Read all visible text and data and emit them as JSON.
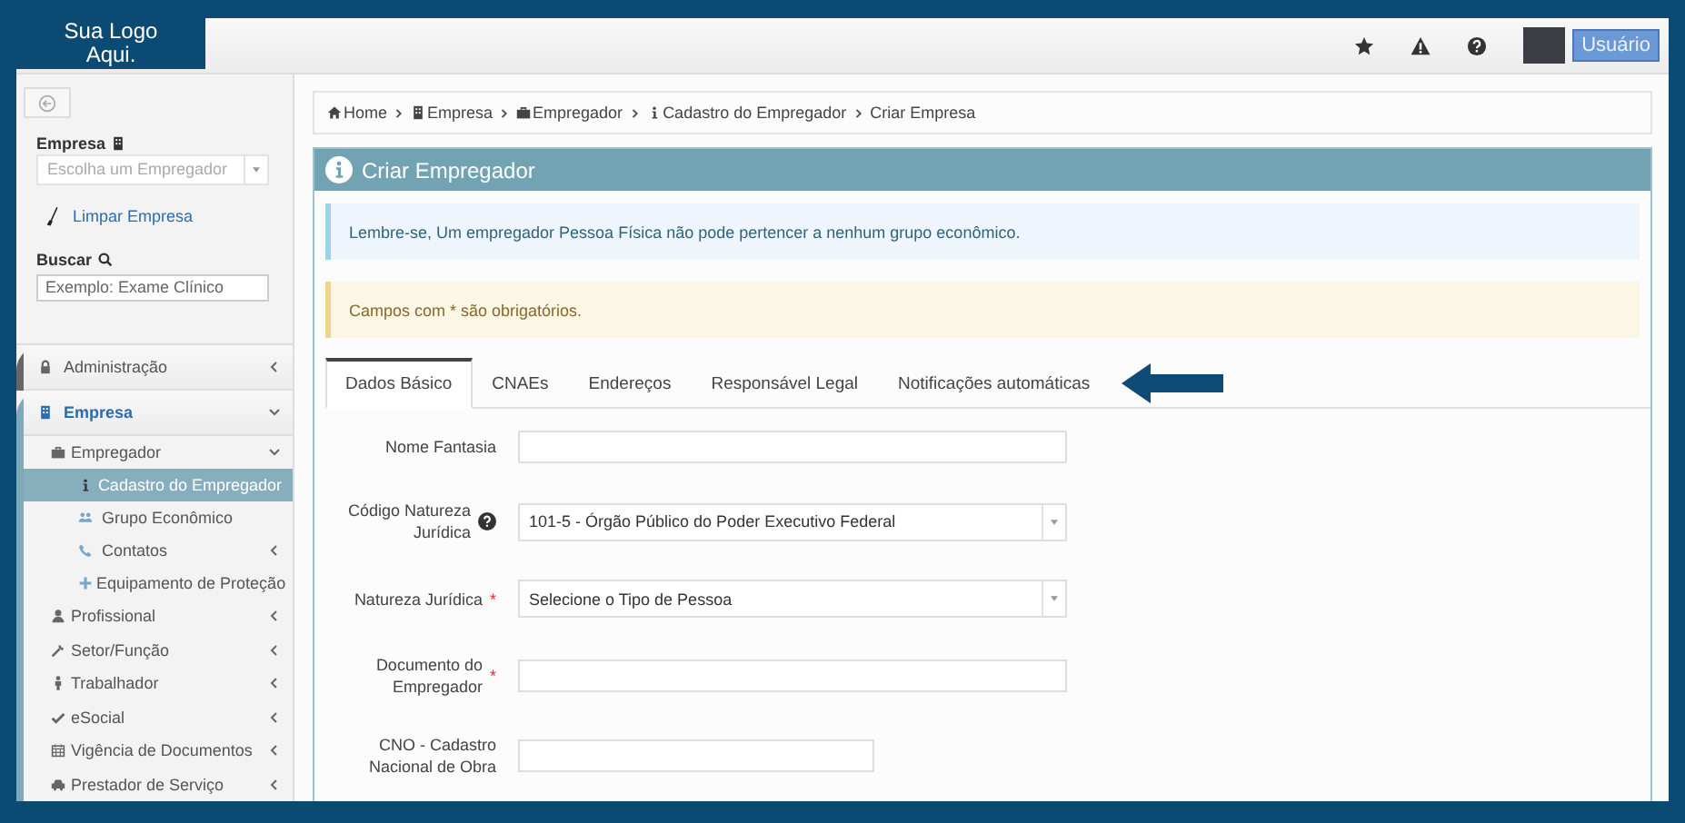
{
  "header": {
    "logo": "Sua Logo Aqui.",
    "user_button": "Usuário"
  },
  "sidebar": {
    "company_label": "Empresa",
    "company_select": {
      "placeholder": "Escolha um Empregador"
    },
    "clear_link": "Limpar Empresa",
    "search_label": "Buscar",
    "search": {
      "placeholder": "Exemplo: Exame Clínico"
    },
    "menu": [
      {
        "label": "Administração",
        "selected": false,
        "expanded": false
      },
      {
        "label": "Empresa",
        "selected": true,
        "expanded": true,
        "children": [
          {
            "label": "Empregador",
            "selected": false,
            "expanded": true,
            "children": [
              {
                "label": "Cadastro do Empregador",
                "selected": true
              },
              {
                "label": "Grupo Econômico",
                "selected": false
              },
              {
                "label": "Contatos",
                "selected": false,
                "expanded": false
              },
              {
                "label": "Equipamento de Proteção",
                "selected": false
              }
            ]
          },
          {
            "label": "Profissional",
            "selected": false,
            "expanded": false
          },
          {
            "label": "Setor/Função",
            "selected": false,
            "expanded": false
          },
          {
            "label": "Trabalhador",
            "selected": false,
            "expanded": false
          },
          {
            "label": "eSocial",
            "selected": false,
            "expanded": false
          },
          {
            "label": "Vigência de Documentos",
            "selected": false,
            "expanded": false
          },
          {
            "label": "Prestador de Serviço",
            "selected": false,
            "expanded": false
          }
        ]
      }
    ]
  },
  "breadcrumb": [
    "Home",
    "Empresa",
    "Empregador",
    "Cadastro do Empregador",
    "Criar Empresa"
  ],
  "panel": {
    "title": "Criar Empregador",
    "info_alert": "Lembre-se, Um empregador Pessoa Física não pode pertencer a nenhum grupo econômico.",
    "warning_alert": "Campos com * são obrigatórios.",
    "tabs": [
      {
        "label": "Dados Básico",
        "selected": true
      },
      {
        "label": "CNAEs",
        "selected": false
      },
      {
        "label": "Endereços",
        "selected": false
      },
      {
        "label": "Responsável Legal",
        "selected": false
      },
      {
        "label": "Notificações automáticas",
        "selected": false
      }
    ],
    "fields": [
      {
        "kind": "text",
        "label": "Nome Fantasia",
        "help": false
      },
      {
        "kind": "select",
        "label": "Código Natureza Jurídica",
        "help": true,
        "value": "101-5 - Órgão Público do Poder Executivo Federal"
      },
      {
        "kind": "select",
        "label": "Natureza Jurídica",
        "required_mark": "*",
        "help": false,
        "value": "Selecione o Tipo de Pessoa"
      },
      {
        "kind": "text",
        "label": "Documento do Empregador",
        "required_mark": "*",
        "help": false
      },
      {
        "kind": "short",
        "label": "CNO - Cadastro Nacional de Obra",
        "help": false
      }
    ]
  }
}
